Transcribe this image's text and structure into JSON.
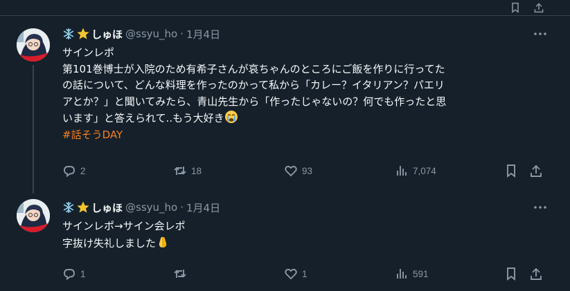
{
  "tweets": [
    {
      "display_name": "しゅほ",
      "handle": "@ssyu_ho",
      "separator": "·",
      "date": "1月4日",
      "lines": [
        "サインレポ",
        "第101巻博士が入院のため有希子さんが哀ちゃんのところにご飯を作りに行ってた",
        "の話について、どんな料理を作ったのかって私から「カレー？イタリアン？パエリ",
        "アとか？」と聞いてみたら、青山先生から「作ったじゃないの？何でも作ったと思",
        "います」と答えられて..もう大好き"
      ],
      "hashtag": "#話そうDAY",
      "replies": "2",
      "retweets": "18",
      "likes": "93",
      "views": "7,074"
    },
    {
      "display_name": "しゅほ",
      "handle": "@ssyu_ho",
      "separator": "·",
      "date": "1月4日",
      "lines": [
        "サインレポ→サイン会レポ",
        "字抜け失礼しました"
      ],
      "replies": "1",
      "retweets": "",
      "likes": "1",
      "views": "591"
    }
  ],
  "icons": {
    "name_prefix": [
      "snowflake-icon",
      "star-icon"
    ],
    "line_end_emoji": [
      "crying-face-icon",
      "folded-hands-icon"
    ],
    "actions": [
      "reply-icon",
      "retweet-icon",
      "like-icon",
      "views-icon",
      "bookmark-icon",
      "share-icon"
    ]
  },
  "colors": {
    "background": "#15202b",
    "divider": "#38444d",
    "text_primary": "#f7f9f9",
    "text_secondary": "#8b98a5",
    "hashtag": "#f7811c",
    "star": "#f4c430",
    "snowflake": "#8ecae6"
  }
}
